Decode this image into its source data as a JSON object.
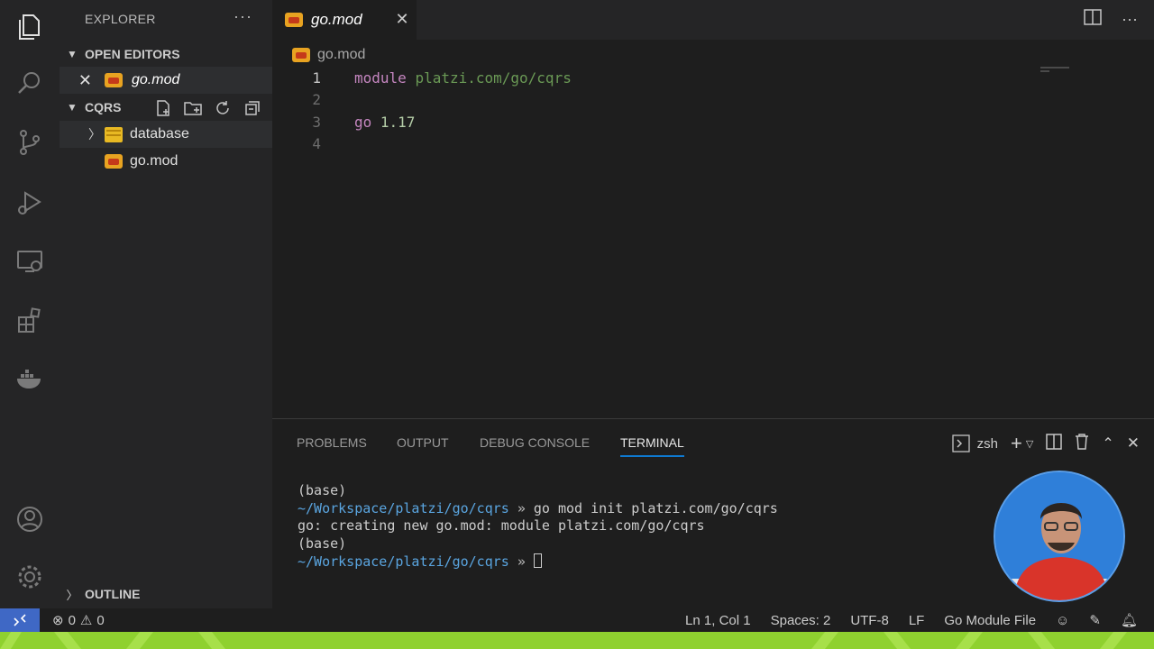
{
  "sidebar": {
    "title": "EXPLORER",
    "more": "···",
    "open_editors_label": "OPEN EDITORS",
    "open_editor_file": "go.mod",
    "project_label": "CQRS",
    "tree": [
      {
        "label": "database",
        "type": "folder"
      },
      {
        "label": "go.mod",
        "type": "file"
      }
    ],
    "outline_label": "OUTLINE"
  },
  "tab": {
    "name": "go.mod"
  },
  "breadcrumb": {
    "file": "go.mod"
  },
  "editor": {
    "lines": [
      {
        "num": "1",
        "kw": "module",
        "rest": "platzi.com/go/cqrs"
      },
      {
        "num": "2"
      },
      {
        "num": "3",
        "kw": "go",
        "rest": "1.17"
      },
      {
        "num": "4"
      }
    ]
  },
  "panel": {
    "tabs": [
      "PROBLEMS",
      "OUTPUT",
      "DEBUG CONSOLE",
      "TERMINAL"
    ],
    "active_tab": "TERMINAL",
    "shell": "zsh",
    "terminal": [
      {
        "text": "(base)"
      },
      {
        "path": "~/Workspace/platzi/go/cqrs",
        "prompt": "»",
        "cmd": "go mod init platzi.com/go/cqrs"
      },
      {
        "text": "go: creating new go.mod: module platzi.com/go/cqrs"
      },
      {
        "text": "(base)"
      },
      {
        "path": "~/Workspace/platzi/go/cqrs",
        "prompt": "»"
      }
    ]
  },
  "status": {
    "errors": "0",
    "warnings": "0",
    "position": "Ln 1, Col 1",
    "spaces": "Spaces: 2",
    "encoding": "UTF-8",
    "eol": "LF",
    "language": "Go Module File"
  },
  "colors": {
    "accent": "#0e7ad1",
    "remote": "#3f68c5",
    "brand_strip": "#8fd12f",
    "keyword": "#c586c0",
    "string": "#6a9955"
  }
}
